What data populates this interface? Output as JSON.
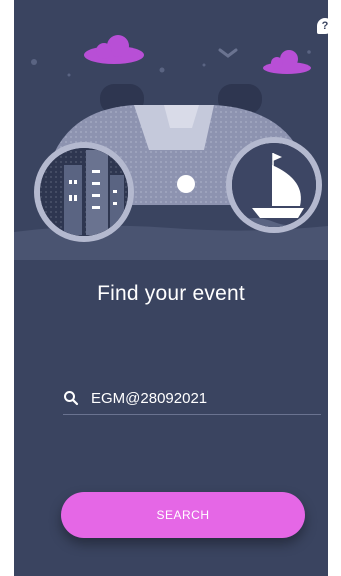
{
  "app": {
    "title": "Find your event",
    "help_icon": "help-icon",
    "help_label": "?"
  },
  "search": {
    "icon": "search-icon",
    "value": "EGM@28092021",
    "placeholder": ""
  },
  "actions": {
    "search_label": "SEARCH"
  },
  "colors": {
    "background": "#3a4460",
    "accent": "#e567e6",
    "cloud": "#b84fd6",
    "illustration_light": "#a9afc8",
    "illustration_dark": "#5a6482"
  }
}
